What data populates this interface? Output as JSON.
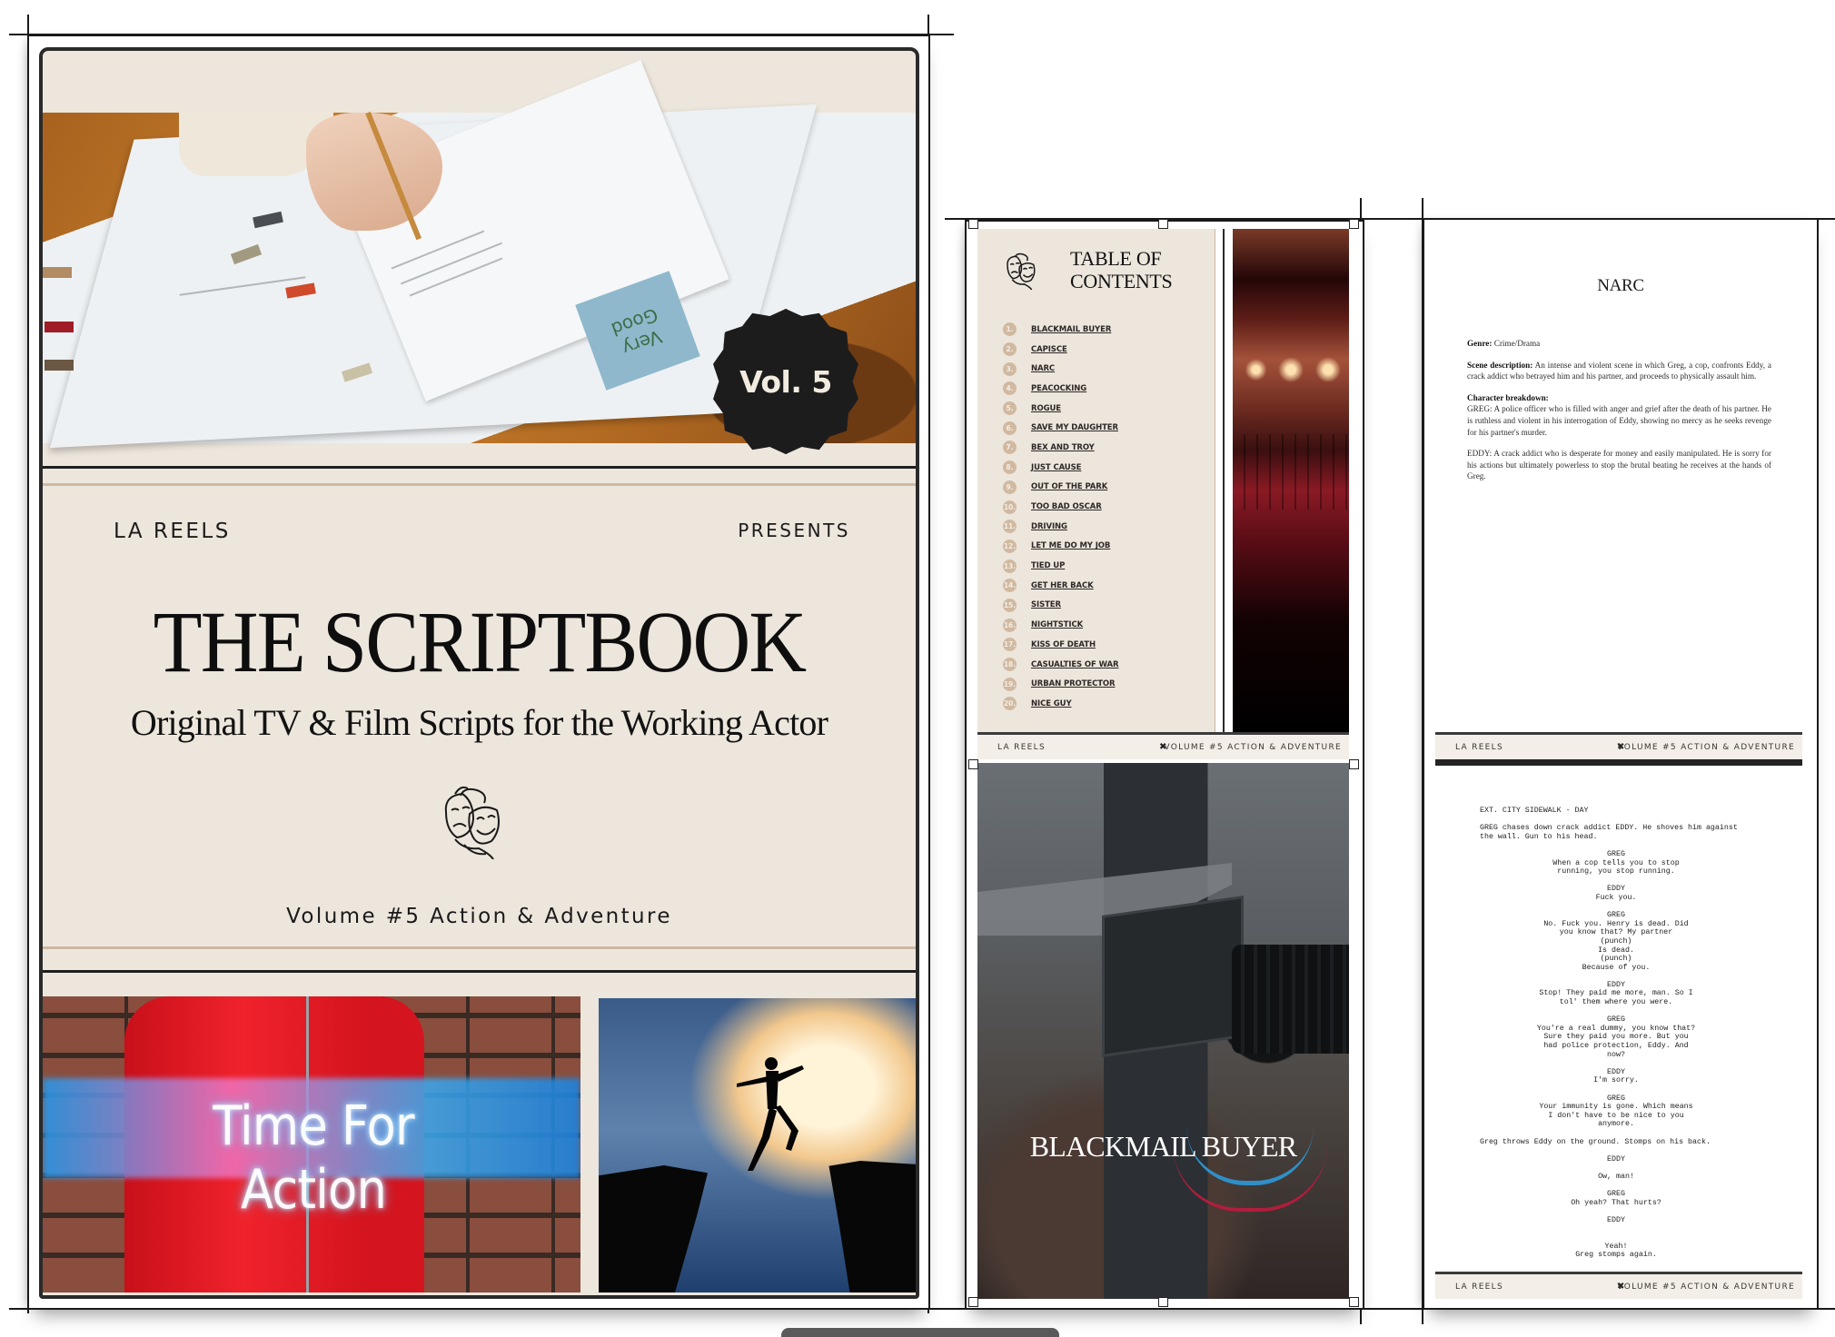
{
  "cover": {
    "badge": "Vol. 5",
    "sticky_note": "Very Good",
    "brand": "LA REELS",
    "presents": "PRESENTS",
    "title": "THE SCRIPTBOOK",
    "subtitle": "Original TV & Film Scripts for the Working Actor",
    "volume": "Volume #5 Action & Adventure",
    "action_image_text": "Time For Action",
    "icons": [
      "theater-masks-icon"
    ]
  },
  "toc": {
    "title_line1": "TABLE OF",
    "title_line2": "CONTENTS",
    "items": [
      {
        "num": "1.",
        "label": "BLACKMAIL BUYER"
      },
      {
        "num": "2.",
        "label": "CAPISCE"
      },
      {
        "num": "3.",
        "label": "NARC"
      },
      {
        "num": "4.",
        "label": "PEACOCKING"
      },
      {
        "num": "5.",
        "label": "ROGUE"
      },
      {
        "num": "6.",
        "label": "SAVE MY DAUGHTER"
      },
      {
        "num": "7.",
        "label": "BEX AND TROY"
      },
      {
        "num": "8.",
        "label": "JUST CAUSE"
      },
      {
        "num": "9.",
        "label": "OUT OF THE PARK"
      },
      {
        "num": "10.",
        "label": "TOO BAD OSCAR"
      },
      {
        "num": "11.",
        "label": "DRIVING"
      },
      {
        "num": "12.",
        "label": "LET ME DO MY JOB"
      },
      {
        "num": "13.",
        "label": "TIED UP"
      },
      {
        "num": "14.",
        "label": "GET HER BACK"
      },
      {
        "num": "15.",
        "label": "SISTER"
      },
      {
        "num": "16.",
        "label": "NIGHTSTICK"
      },
      {
        "num": "17.",
        "label": "KISS OF DEATH"
      },
      {
        "num": "18.",
        "label": "CASUALTIES OF WAR"
      },
      {
        "num": "19.",
        "label": "URBAN PROTECTOR"
      },
      {
        "num": "20.",
        "label": "NICE GUY"
      }
    ]
  },
  "footer": {
    "left": "LA REELS",
    "separator": "✖",
    "right": "VOLUME #5 ACTION & ADVENTURE"
  },
  "script_cover": {
    "title": "BLACKMAIL BUYER"
  },
  "narc": {
    "title": "NARC",
    "genre_label": "Genre:",
    "genre": "Crime/Drama",
    "scene_label": "Scene description:",
    "scene": "An intense and violent scene in which Greg, a cop, confronts Eddy, a crack addict who betrayed him and his partner, and proceeds to physically assault him.",
    "breakdown_label": "Character breakdown:",
    "greg": "GREG: A police officer who is filled with anger and grief after the death of his partner. He is ruthless and violent in his interrogation of Eddy, showing no mercy as he seeks revenge for his partner's murder.",
    "eddy": "EDDY: A crack addict who is desperate for money and easily manipulated. He is sorry for his actions but ultimately powerless to stop the brutal beating he receives at the hands of Greg."
  },
  "script": {
    "lines": [
      {
        "t": "EXT. CITY SIDEWALK - DAY",
        "c": false
      },
      {
        "t": "",
        "c": false
      },
      {
        "t": "GREG chases down crack addict EDDY. He shoves him against",
        "c": false
      },
      {
        "t": "the wall. Gun to his head.",
        "c": false
      },
      {
        "t": "",
        "c": false
      },
      {
        "t": "GREG",
        "c": true
      },
      {
        "t": "When a cop tells you to stop",
        "c": true
      },
      {
        "t": "running, you stop running.",
        "c": true
      },
      {
        "t": "",
        "c": false
      },
      {
        "t": "EDDY",
        "c": true
      },
      {
        "t": "Fuck you.",
        "c": true
      },
      {
        "t": "",
        "c": false
      },
      {
        "t": "GREG",
        "c": true
      },
      {
        "t": "No. Fuck you. Henry is dead. Did",
        "c": true
      },
      {
        "t": "you know that? My partner",
        "c": true
      },
      {
        "t": "(punch)",
        "c": true
      },
      {
        "t": "Is dead.",
        "c": true
      },
      {
        "t": "(punch)",
        "c": true
      },
      {
        "t": "Because of you.",
        "c": true
      },
      {
        "t": "",
        "c": false
      },
      {
        "t": "EDDY",
        "c": true
      },
      {
        "t": "Stop! They paid me more, man. So I",
        "c": true
      },
      {
        "t": "tol' them where you were.",
        "c": true
      },
      {
        "t": "",
        "c": false
      },
      {
        "t": "GREG",
        "c": true
      },
      {
        "t": "You're a real dummy, you know that?",
        "c": true
      },
      {
        "t": "Sure they paid you more. But you",
        "c": true
      },
      {
        "t": "had police protection, Eddy. And",
        "c": true
      },
      {
        "t": "now?",
        "c": true
      },
      {
        "t": "",
        "c": false
      },
      {
        "t": "EDDY",
        "c": true
      },
      {
        "t": "I'm sorry.",
        "c": true
      },
      {
        "t": "",
        "c": false
      },
      {
        "t": "GREG",
        "c": true
      },
      {
        "t": "Your immunity is gone. Which means",
        "c": true
      },
      {
        "t": "I don't have to be nice to you",
        "c": true
      },
      {
        "t": "anymore.",
        "c": true
      },
      {
        "t": "",
        "c": false
      },
      {
        "t": "Greg throws Eddy on the ground. Stomps on his back.",
        "c": false
      },
      {
        "t": "",
        "c": false
      },
      {
        "t": "EDDY",
        "c": true
      },
      {
        "t": "",
        "c": false
      },
      {
        "t": "Ow, man!",
        "c": true
      },
      {
        "t": "",
        "c": false
      },
      {
        "t": "GREG",
        "c": true
      },
      {
        "t": "Oh yeah? That hurts?",
        "c": true
      },
      {
        "t": "",
        "c": false
      },
      {
        "t": "EDDY",
        "c": true
      },
      {
        "t": "",
        "c": false
      },
      {
        "t": "",
        "c": false
      },
      {
        "t": "Yeah!",
        "c": true
      },
      {
        "t": "Greg stomps again.",
        "c": true
      }
    ]
  },
  "colors": {
    "beige": "#ede6dc",
    "tan_accent": "#d1b9a1",
    "badge": "#1d1c1c",
    "ink": "#121212"
  }
}
